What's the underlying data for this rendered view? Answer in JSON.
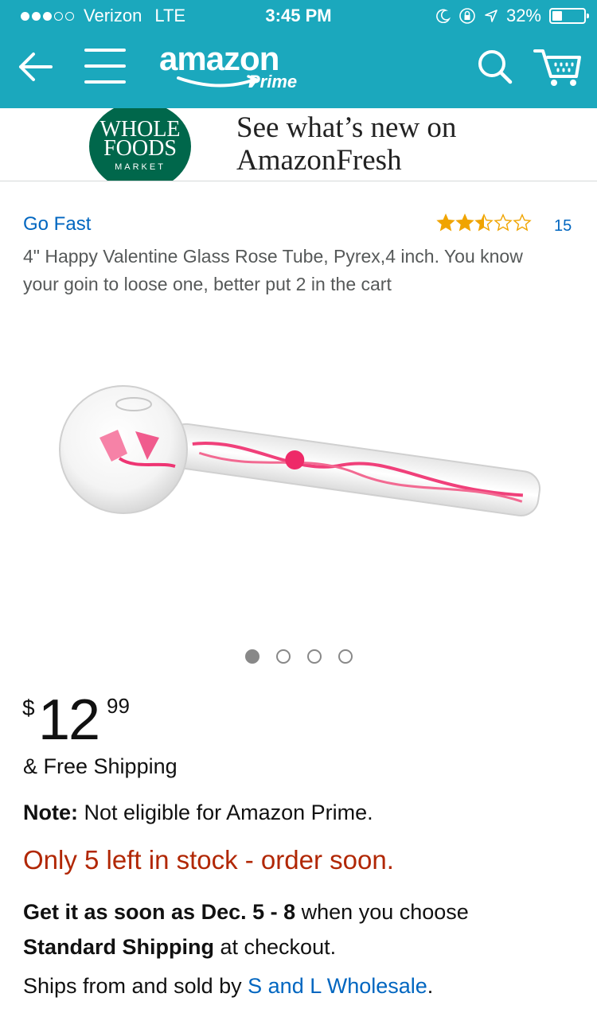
{
  "status_bar": {
    "carrier": "Verizon",
    "network": "LTE",
    "time": "3:45 PM",
    "battery": "32%",
    "battery_level": 0.32
  },
  "navbar": {
    "logo_text": "amazon",
    "logo_sub": "Prime",
    "icons": [
      "back-arrow-icon",
      "menu-icon",
      "search-icon",
      "cart-icon"
    ]
  },
  "banner": {
    "logo_line1": "WHOLE",
    "logo_line2": "FOODS",
    "logo_line3": "MARKET",
    "text_line1": "See what’s new on",
    "text_line2": "AmazonFresh"
  },
  "product": {
    "brand": "Go Fast",
    "rating": 2.5,
    "rating_count": "15",
    "title": "4\" Happy Valentine Glass Rose Tube, Pyrex,4 inch. You know your goin to loose one, better put 2 in the cart",
    "image_count": 4,
    "image_active": 1,
    "price_currency": "$",
    "price_whole": "12",
    "price_fraction": "99",
    "shipping": "& Free Shipping",
    "note_label": "Note:",
    "note_text": " Not eligible for Amazon Prime.",
    "stock": "Only 5 left in stock - order soon.",
    "delivery_prefix": "Get it as soon as Dec. 5 - 8",
    "delivery_middle": " when you choose ",
    "delivery_method": "Standard Shipping",
    "delivery_suffix": " at checkout.",
    "seller_prefix": "Ships from and sold by ",
    "seller_name": "S and L Wholesale",
    "seller_suffix": "."
  },
  "colors": {
    "header": "#1ba8bd",
    "link": "#0066c0",
    "stock": "#b12704",
    "star": "#f0a400",
    "whole_foods": "#00674b"
  }
}
